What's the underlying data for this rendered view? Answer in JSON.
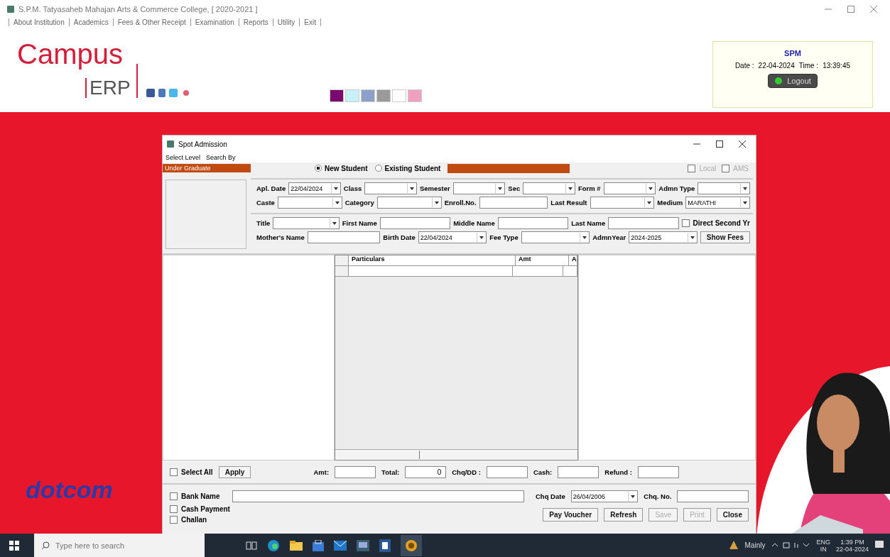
{
  "window": {
    "title": "S.P.M. Tatyasaheb Mahajan Arts & Commerce College, [ 2020-2021 ]"
  },
  "menu": [
    "About Institution",
    "Academics",
    "Fees & Other Receipt",
    "Examination",
    "Reports",
    "Utility",
    "Exit"
  ],
  "logo": {
    "main": "Campus",
    "sub": "ERP"
  },
  "themes": [
    {
      "color": "#7a0a6e",
      "selected": false
    },
    {
      "color": "#c8f0f8",
      "selected": false
    },
    {
      "color": "#8ca0c8",
      "selected": false
    },
    {
      "color": "#9a9a9a",
      "selected": false
    },
    {
      "color": "#ffffff",
      "selected": false
    },
    {
      "color": "#f0a0c0",
      "selected": false
    }
  ],
  "user_box": {
    "user": "SPM",
    "date_label": "Date :",
    "date": "22-04-2024",
    "time_label": "Time :",
    "time": "13:39:45",
    "logout": "Logout"
  },
  "brand": "dotcom",
  "dialog": {
    "title": "Spot Admission",
    "menu": [
      "Select Level",
      "Search By"
    ],
    "levels": [
      {
        "label": "Under Graduate",
        "selected": true
      }
    ],
    "student_type": [
      {
        "label": "New Student",
        "selected": true
      },
      {
        "label": "Existing Student",
        "selected": false
      }
    ],
    "options": [
      {
        "label": "Local",
        "checked": false,
        "disabled": true
      },
      {
        "label": "AMS",
        "checked": false,
        "disabled": true
      }
    ],
    "form_groups": [
      [
        [
          {
            "kind": "combo",
            "label": "Apl. Date",
            "value": "22/04/2024"
          },
          {
            "kind": "combo",
            "label": "Class"
          },
          {
            "kind": "combo",
            "label": "Semester"
          },
          {
            "kind": "combo",
            "label": "Sec"
          },
          {
            "kind": "combo",
            "label": "Form #"
          },
          {
            "kind": "combo",
            "label": "Admn Type"
          }
        ],
        [
          {
            "kind": "combo",
            "label": "Caste"
          },
          {
            "kind": "combo",
            "label": "Category"
          },
          {
            "kind": "text",
            "label": "Enroll.No."
          },
          {
            "kind": "combo",
            "label": "Last Result"
          },
          {
            "kind": "combo",
            "label": "Medium",
            "value": "MARATHI"
          }
        ]
      ],
      [
        [
          {
            "kind": "combo",
            "label": "Title"
          },
          {
            "kind": "text",
            "label": "First Name"
          },
          {
            "kind": "text",
            "label": "Middle Name"
          },
          {
            "kind": "text",
            "label": "Last Name"
          },
          {
            "kind": "check",
            "label": "Direct Second Yr",
            "checked": false
          }
        ],
        [
          {
            "kind": "text",
            "label": "Mother's Name"
          },
          {
            "kind": "combo",
            "label": "Birth Date",
            "value": "22/04/2024"
          },
          {
            "kind": "combo",
            "label": "Fee Type"
          },
          {
            "kind": "combo",
            "label": "AdmnYear",
            "value": "2024-2025"
          },
          {
            "kind": "button",
            "label": "Show Fees"
          }
        ]
      ]
    ],
    "fee_table": {
      "columns": [
        "Particulars",
        "Amt",
        "A"
      ]
    },
    "totals": [
      {
        "kind": "check",
        "label": "Select All",
        "checked": false
      },
      {
        "kind": "button",
        "label": "Apply"
      },
      {
        "kind": "text",
        "label": "Amt:"
      },
      {
        "kind": "text",
        "label": "Total:",
        "value": "0"
      },
      {
        "kind": "text",
        "label": "Chq/DD :"
      },
      {
        "kind": "text",
        "label": "Cash:"
      },
      {
        "kind": "text",
        "label": "Refund :"
      }
    ],
    "payment": [
      {
        "label": "Bank Name",
        "checked": false
      },
      {
        "label": "Cash Payment",
        "checked": false
      },
      {
        "label": "Challan",
        "checked": false
      }
    ],
    "cheque": [
      {
        "kind": "combo",
        "label": "Chq Date",
        "value": "26/04/2006"
      },
      {
        "kind": "text",
        "label": "Chq. No."
      }
    ],
    "buttons": [
      {
        "label": "Pay Voucher",
        "disabled": false
      },
      {
        "label": "Refresh",
        "disabled": false
      },
      {
        "label": "Save",
        "disabled": true
      },
      {
        "label": "Print",
        "disabled": true
      },
      {
        "label": "Close",
        "disabled": false
      }
    ]
  },
  "taskbar": {
    "search": {
      "placeholder": "Type here to search"
    },
    "weather": "Mainly",
    "lang": "ENG",
    "region": "IN",
    "time": "1:39 PM",
    "date": "22-04-2024"
  }
}
